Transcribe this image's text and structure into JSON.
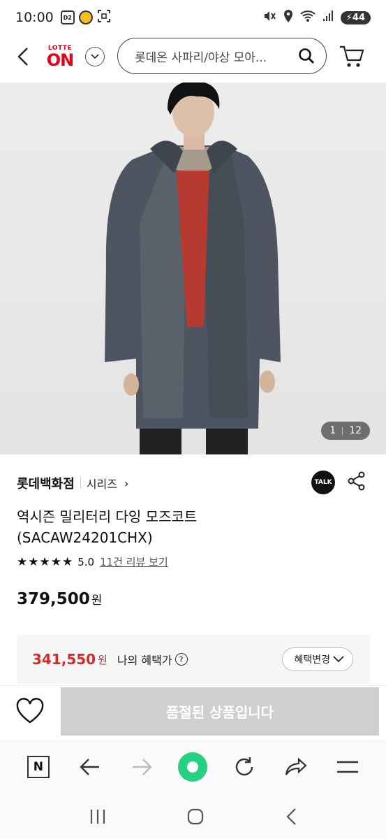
{
  "status_bar": {
    "time": "10:00",
    "small_badge": "D2",
    "battery": "44"
  },
  "header": {
    "logo_top": "LOTTE",
    "logo_main": "ON",
    "search_placeholder": "롯데온 사파리/야상 모아..."
  },
  "gallery": {
    "current": "1",
    "total": "12"
  },
  "product": {
    "brand": "롯데백화점",
    "series": "시리즈",
    "series_arrow": "›",
    "talk_label": "TALK",
    "title_line1": "역시즌 밀리터리 다잉 모즈코트",
    "title_line2": "(SACAW24201CHX)",
    "rating_stars": 5,
    "rating": "5.0",
    "review_link": "11건 리뷰 보기",
    "price": "379,500",
    "price_unit": "원"
  },
  "benefit": {
    "price": "341,550",
    "unit": "원",
    "label": "나의 혜택가",
    "help": "?",
    "change_button": "혜택변경"
  },
  "actions": {
    "soldout_label": "품절된 상품입니다"
  },
  "browser": {
    "n_label": "N"
  },
  "colors": {
    "brand_red": "#e60012",
    "benefit_red": "#d62b2b",
    "disabled_gray": "#cfcfcf",
    "accent_green": "#27d083"
  }
}
